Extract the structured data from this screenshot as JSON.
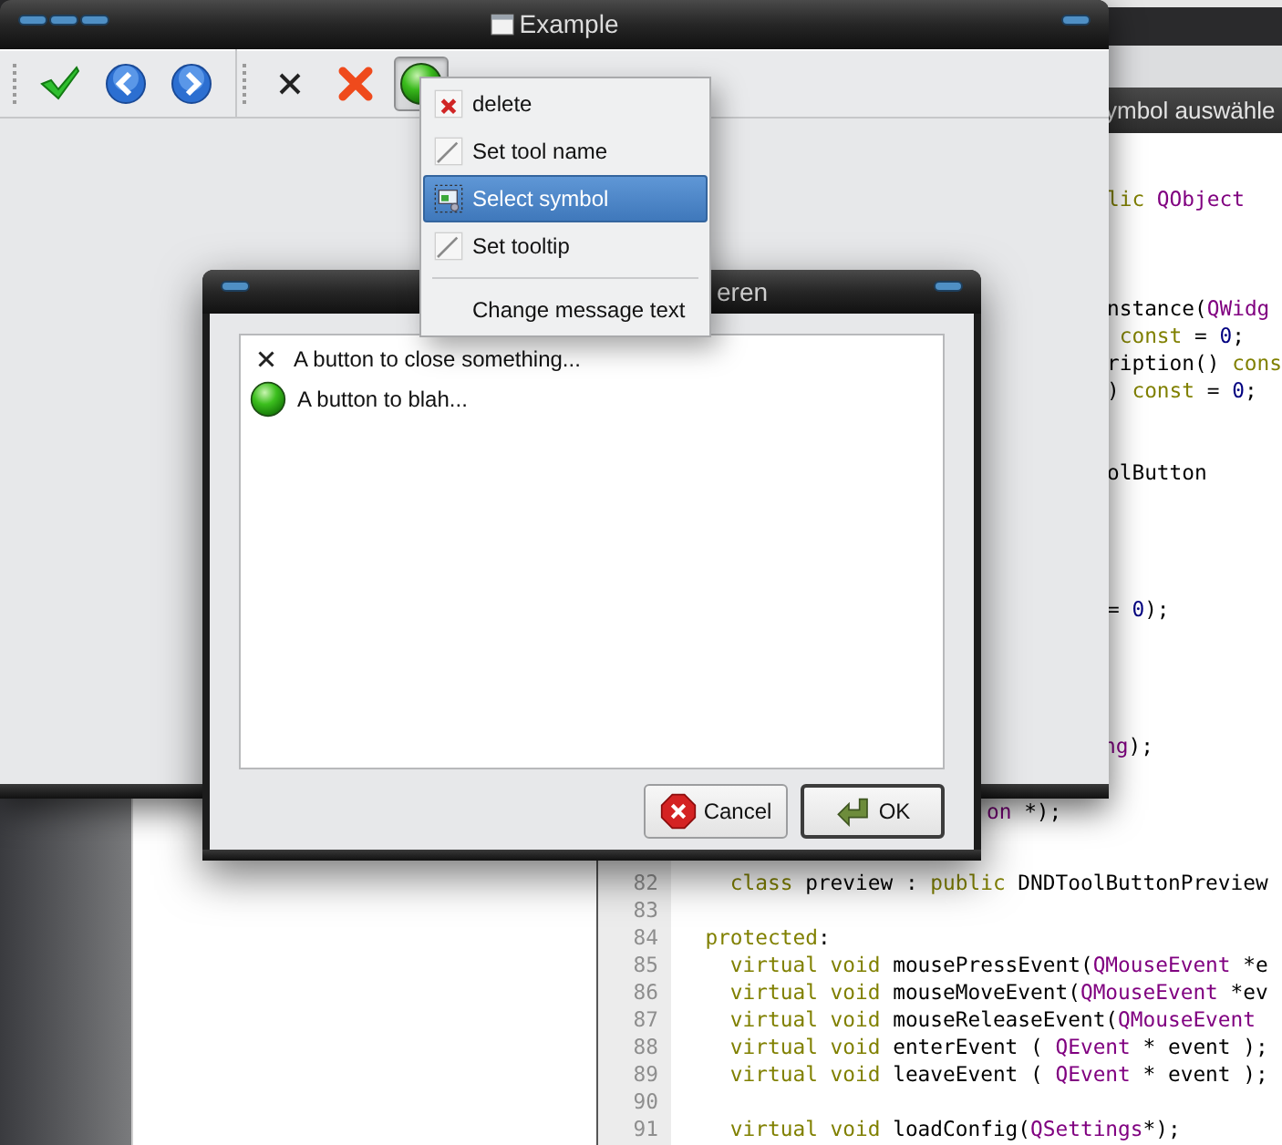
{
  "editor_window": {
    "title": "ymbol auswähle",
    "lines": [
      {
        "segments": [
          {
            "text": "lic",
            "kind": "keyword"
          },
          {
            "text": " QObject",
            "kind": "type"
          }
        ]
      },
      {
        "segments": [
          {
            "text": "nstance(",
            "kind": "plain"
          },
          {
            "text": "QWidg",
            "kind": "type"
          }
        ]
      },
      {
        "segments": [
          {
            "text": " const",
            "kind": "keyword"
          },
          {
            "text": " = ",
            "kind": "plain"
          },
          {
            "text": "0",
            "kind": "number"
          },
          {
            "text": ";",
            "kind": "plain"
          }
        ]
      },
      {
        "segments": [
          {
            "text": "ription() ",
            "kind": "plain"
          },
          {
            "text": "cons",
            "kind": "keyword"
          }
        ]
      },
      {
        "segments": [
          {
            "text": ") ",
            "kind": "plain"
          },
          {
            "text": "const",
            "kind": "keyword"
          },
          {
            "text": " = ",
            "kind": "plain"
          },
          {
            "text": "0",
            "kind": "number"
          },
          {
            "text": ";",
            "kind": "plain"
          }
        ]
      },
      {
        "segments": [
          {
            "text": "olButton",
            "kind": "plain"
          }
        ]
      },
      {
        "segments": [
          {
            "text": "= ",
            "kind": "plain"
          },
          {
            "text": "0",
            "kind": "number"
          },
          {
            "text": ");",
            "kind": "plain"
          }
        ]
      },
      {
        "segments": [
          {
            "text": "ng",
            "kind": "type"
          },
          {
            "text": ");",
            "kind": "plain"
          }
        ]
      },
      {
        "segments": [
          {
            "text": "on",
            "kind": "type"
          },
          {
            "text": " *);",
            "kind": "plain"
          }
        ]
      },
      {
        "number": "82",
        "segments": [
          {
            "text": "    class",
            "kind": "keyword"
          },
          {
            "text": " preview : ",
            "kind": "plain"
          },
          {
            "text": "public",
            "kind": "keyword"
          },
          {
            "text": " DNDToolButtonPreview",
            "kind": "plain"
          }
        ]
      },
      {
        "number": "83"
      },
      {
        "number": "84",
        "segments": [
          {
            "text": "  protected",
            "kind": "keyword"
          },
          {
            "text": ":",
            "kind": "plain"
          }
        ]
      },
      {
        "number": "85",
        "segments": [
          {
            "text": "    virtual void",
            "kind": "keyword"
          },
          {
            "text": " mousePressEvent(",
            "kind": "plain"
          },
          {
            "text": "QMouseEvent",
            "kind": "type"
          },
          {
            "text": " *e",
            "kind": "plain"
          }
        ]
      },
      {
        "number": "86",
        "segments": [
          {
            "text": "    virtual void",
            "kind": "keyword"
          },
          {
            "text": " mouseMoveEvent(",
            "kind": "plain"
          },
          {
            "text": "QMouseEvent",
            "kind": "type"
          },
          {
            "text": " *ev",
            "kind": "plain"
          }
        ]
      },
      {
        "number": "87",
        "segments": [
          {
            "text": "    virtual void",
            "kind": "keyword"
          },
          {
            "text": " mouseReleaseEvent(",
            "kind": "plain"
          },
          {
            "text": "QMouseEvent",
            "kind": "type"
          }
        ]
      },
      {
        "number": "88",
        "segments": [
          {
            "text": "    virtual void",
            "kind": "keyword"
          },
          {
            "text": " enterEvent ( ",
            "kind": "plain"
          },
          {
            "text": "QEvent",
            "kind": "type"
          },
          {
            "text": " * event );",
            "kind": "plain"
          }
        ]
      },
      {
        "number": "89",
        "segments": [
          {
            "text": "    virtual void",
            "kind": "keyword"
          },
          {
            "text": " leaveEvent ( ",
            "kind": "plain"
          },
          {
            "text": "QEvent",
            "kind": "type"
          },
          {
            "text": " * event );",
            "kind": "plain"
          }
        ]
      },
      {
        "number": "90"
      },
      {
        "number": "91",
        "segments": [
          {
            "text": "    virtual void",
            "kind": "keyword"
          },
          {
            "text": " loadConfig(",
            "kind": "plain"
          },
          {
            "text": "QSettings",
            "kind": "type"
          },
          {
            "text": "*);",
            "kind": "plain"
          }
        ]
      }
    ]
  },
  "main_window": {
    "title": "Example",
    "toolbar_groups": [
      [
        {
          "kind": "check",
          "pressed": false
        },
        {
          "kind": "back",
          "pressed": false
        },
        {
          "kind": "forward",
          "pressed": false
        }
      ],
      [
        {
          "kind": "close",
          "pressed": false
        },
        {
          "kind": "delete",
          "pressed": false
        },
        {
          "kind": "ball",
          "pressed": true
        }
      ]
    ]
  },
  "context_menu": {
    "sections": [
      [
        {
          "label": "delete",
          "selected": false
        },
        {
          "label": "Set tool name",
          "selected": false
        },
        {
          "label": "Select symbol",
          "selected": true
        },
        {
          "label": "Set tooltip",
          "selected": false
        }
      ],
      [
        {
          "label": "Change message text",
          "selected": false
        }
      ]
    ]
  },
  "dialog": {
    "title": "eren",
    "items": [
      {
        "label": "A button to close something..."
      },
      {
        "label": "A button to blah..."
      }
    ],
    "buttons": [
      {
        "label": "Cancel",
        "default": false
      },
      {
        "label": "OK",
        "default": true
      }
    ]
  }
}
